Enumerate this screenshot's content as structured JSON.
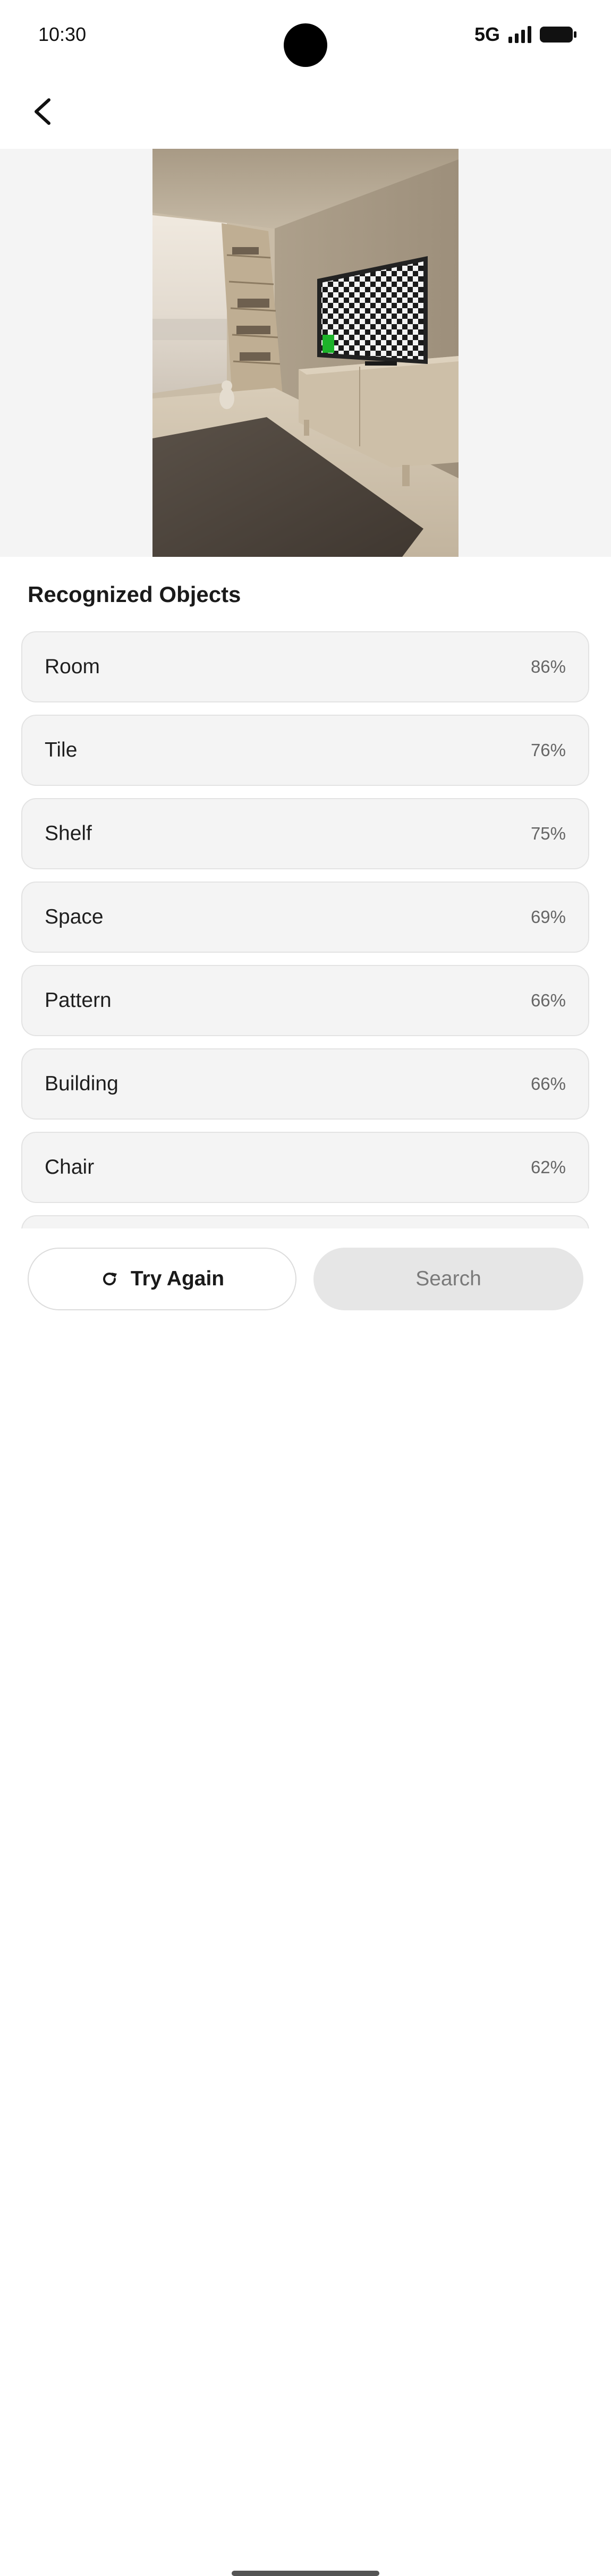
{
  "status_bar": {
    "time": "10:30",
    "network": "5G",
    "icons": [
      "signal-icon",
      "battery-icon"
    ]
  },
  "header": {
    "back_icon": "chevron-left-icon"
  },
  "photo": {
    "description_icon": "room-photo"
  },
  "section": {
    "title": "Recognized Objects"
  },
  "objects": [
    {
      "label": "Room",
      "score": "86%"
    },
    {
      "label": "Tile",
      "score": "76%"
    },
    {
      "label": "Shelf",
      "score": "75%"
    },
    {
      "label": "Space",
      "score": "69%"
    },
    {
      "label": "Pattern",
      "score": "66%"
    },
    {
      "label": "Building",
      "score": "66%"
    },
    {
      "label": "Chair",
      "score": "62%"
    }
  ],
  "actions": {
    "try_again_label": "Try Again",
    "try_again_icon": "refresh-icon",
    "search_label": "Search"
  },
  "colors": {
    "background": "#ffffff",
    "item_background": "#f4f4f4",
    "search_disabled": "#e6e6e6",
    "tv_marker": "#1db32a"
  }
}
